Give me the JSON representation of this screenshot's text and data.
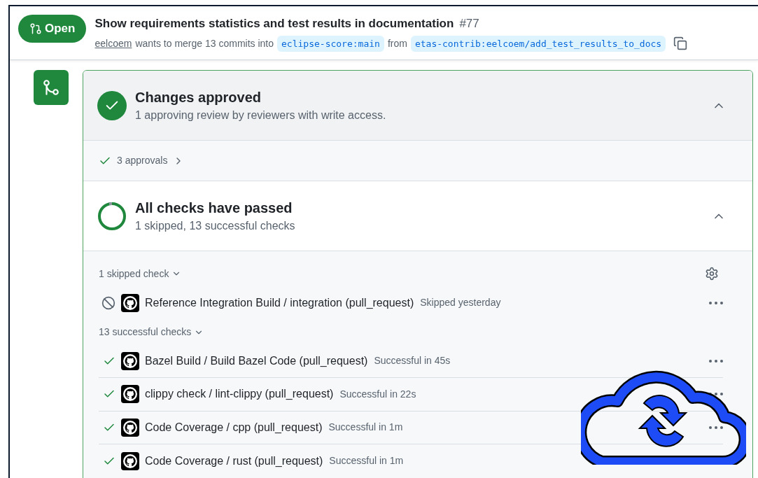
{
  "pr": {
    "status": "Open",
    "title": "Show requirements statistics and test results in documentation",
    "number": "#77",
    "author": "eelcoem",
    "merge_text": "wants to merge 13 commits into",
    "base": "eclipse-score:main",
    "from": "from",
    "head": "etas-contrib:eelcoem/add_test_results_to_docs"
  },
  "review": {
    "title": "Changes approved",
    "subtitle": "1 approving review by reviewers with write access.",
    "expanded": true
  },
  "approvals": "3 approvals",
  "checks": {
    "title": "All checks have passed",
    "subtitle": "1 skipped, 13 successful checks",
    "expanded": true
  },
  "groups": [
    {
      "label": "1 skipped check",
      "expanded": true,
      "items": [
        {
          "kind": "skipped",
          "name": "Reference Integration Build / integration (pull_request)",
          "result": "Skipped yesterday"
        }
      ]
    },
    {
      "label": "13 successful checks",
      "expanded": true,
      "items": [
        {
          "kind": "success",
          "name": "Bazel Build / Build Bazel Code (pull_request)",
          "result": "Successful in 45s"
        },
        {
          "kind": "success",
          "name": "clippy check / lint-clippy (pull_request)",
          "result": "Successful in 22s"
        },
        {
          "kind": "success",
          "name": "Code Coverage / cpp (pull_request)",
          "result": "Successful in 1m"
        },
        {
          "kind": "success",
          "name": "Code Coverage / rust (pull_request)",
          "result": "Successful in 1m"
        }
      ]
    }
  ]
}
